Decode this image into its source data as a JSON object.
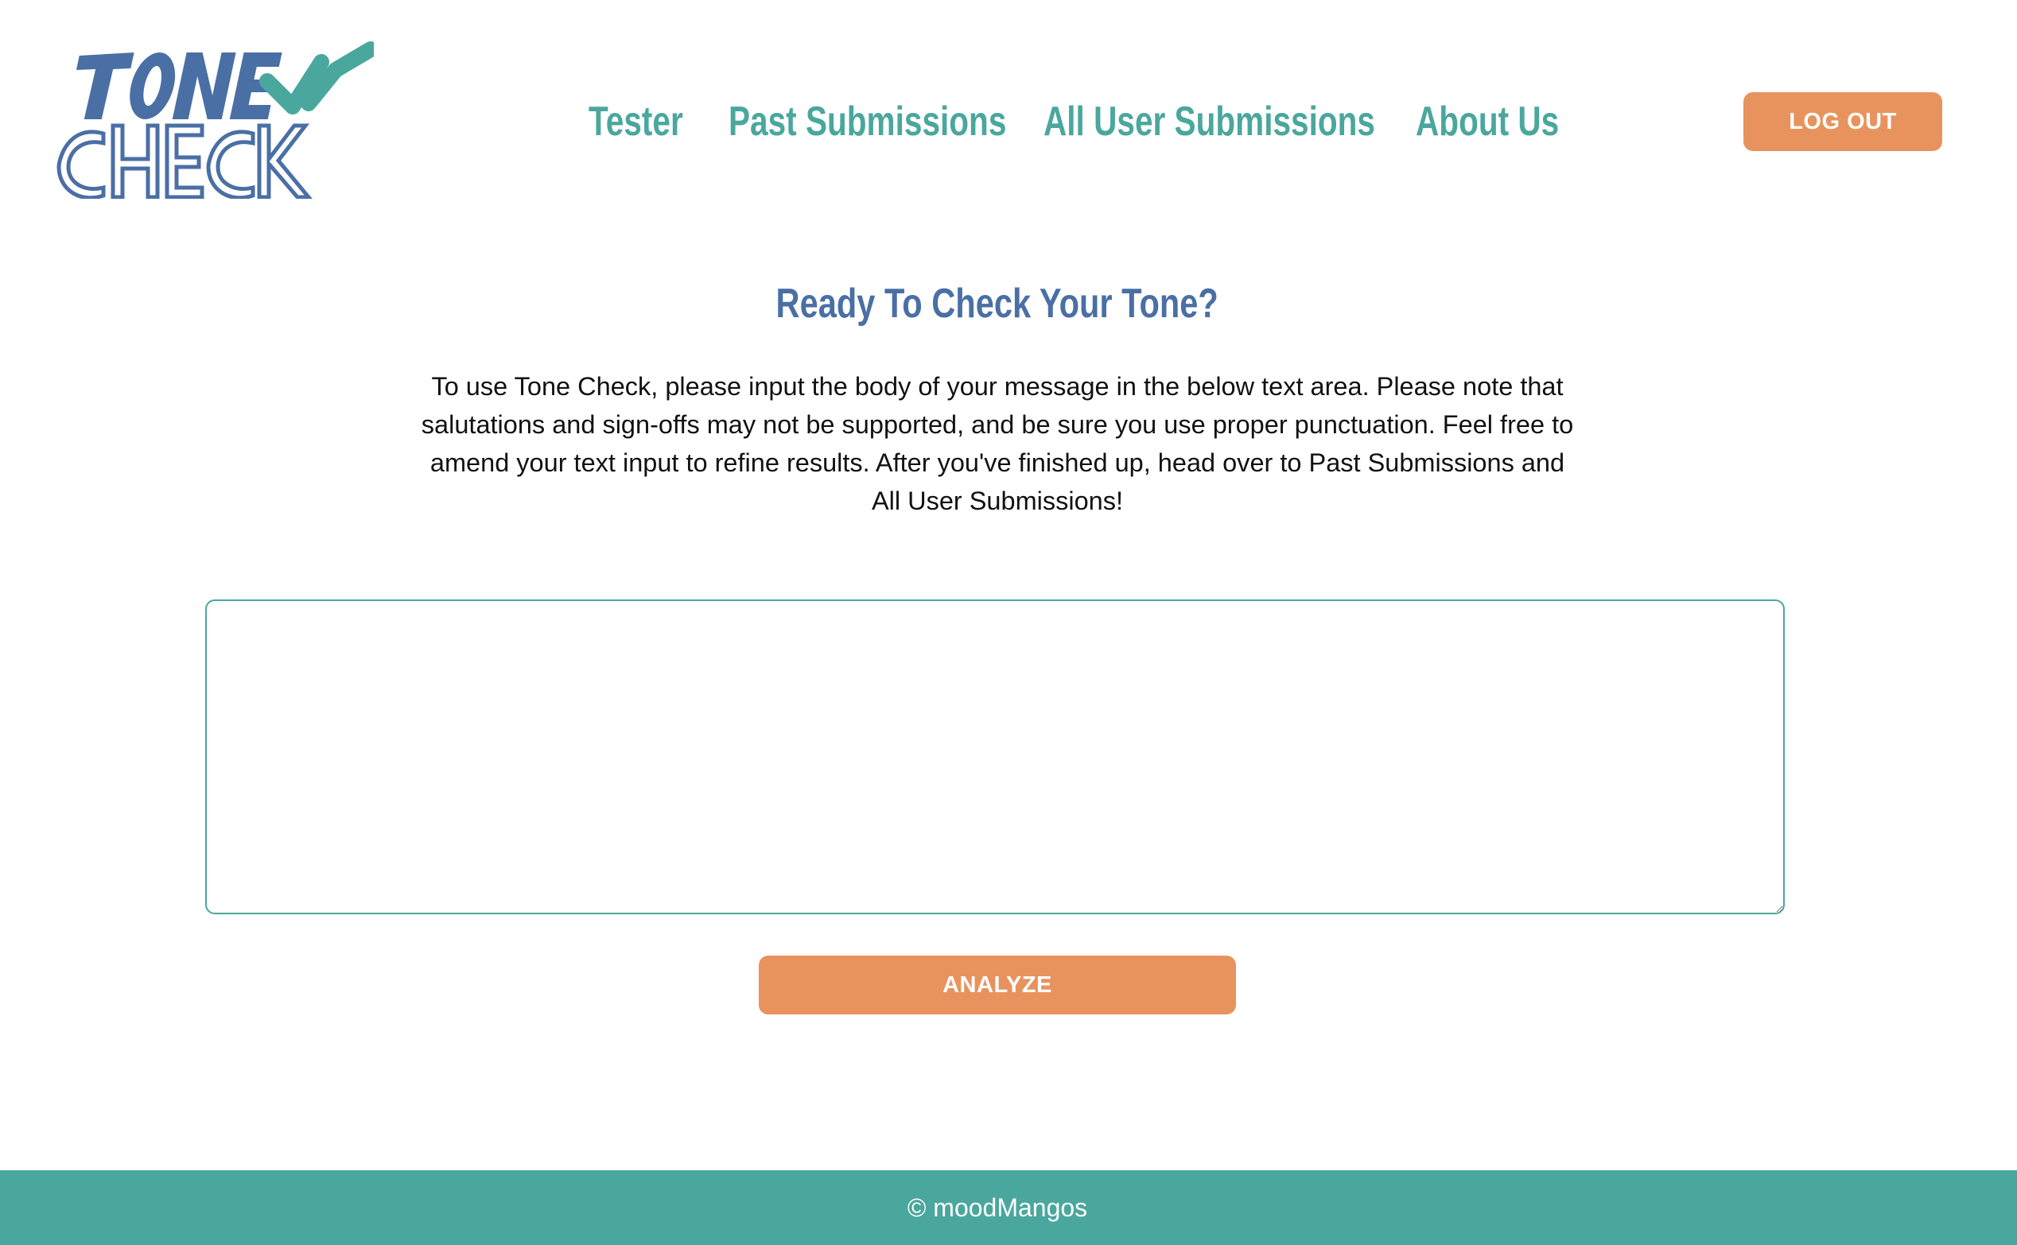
{
  "brand": {
    "logo_top": "TONE",
    "logo_bottom": "CHECK",
    "logo_blue": "#4a6fa5",
    "logo_teal": "#4aa79d"
  },
  "nav": {
    "items": [
      {
        "label": "Tester"
      },
      {
        "label": "Past Submissions"
      },
      {
        "label": "All User Submissions"
      },
      {
        "label": "About Us"
      }
    ],
    "logout_label": "LOG OUT"
  },
  "main": {
    "title": "Ready To Check Your Tone?",
    "intro": "To use Tone Check, please input the body of your message in the below text area. Please note that salutations and sign-offs may not be supported, and be sure you use proper punctuation. Feel free to amend your text input to refine results. After you've finished up, head over to Past Submissions and All User Submissions!",
    "textarea_value": "",
    "analyze_label": "ANALYZE"
  },
  "footer": {
    "text": "© moodMangos"
  },
  "colors": {
    "teal": "#4aa79d",
    "blue": "#4a6fa5",
    "orange": "#e8935d",
    "text": "#111111"
  }
}
